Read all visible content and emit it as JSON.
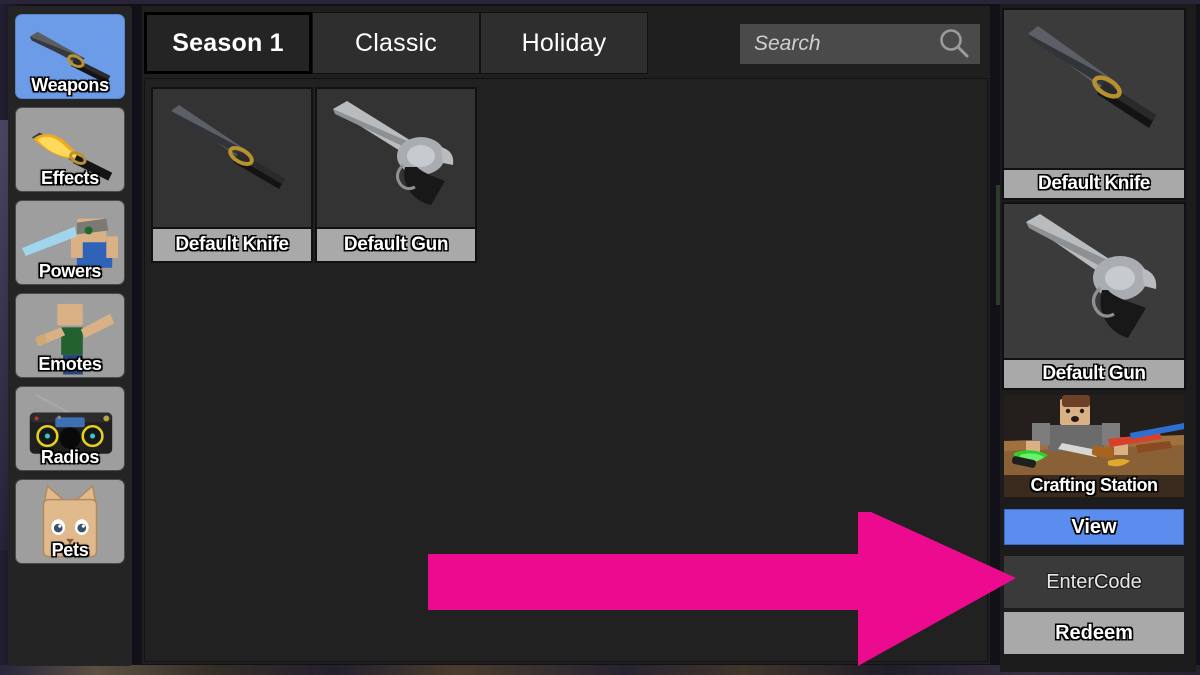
{
  "theme": {
    "panel_bg": "#1f1f1f",
    "content_bg": "#212121",
    "active_tab_bg": "#242424",
    "tab_bg": "#2e2e2e",
    "accent_blue": "#5b8def",
    "sidebar_active_blue": "#6c9ce8",
    "label_gray": "#a9a9a9",
    "annotation_pink": "#ec0b8e"
  },
  "sidebar": {
    "items": [
      {
        "label": "Weapons",
        "icon": "knife-icon",
        "active": true
      },
      {
        "label": "Effects",
        "icon": "flaming-knife-icon",
        "active": false
      },
      {
        "label": "Powers",
        "icon": "laser-power-icon",
        "active": false
      },
      {
        "label": "Emotes",
        "icon": "dab-emote-icon",
        "active": false
      },
      {
        "label": "Radios",
        "icon": "boombox-icon",
        "active": false
      },
      {
        "label": "Pets",
        "icon": "cat-pet-icon",
        "active": false
      }
    ]
  },
  "main": {
    "tabs": [
      {
        "label": "Season 1",
        "active": true
      },
      {
        "label": "Classic",
        "active": false
      },
      {
        "label": "Holiday",
        "active": false
      }
    ],
    "search": {
      "placeholder": "Search",
      "value": "",
      "icon": "search-icon"
    },
    "items": [
      {
        "label": "Default Knife",
        "icon": "knife-item-icon"
      },
      {
        "label": "Default Gun",
        "icon": "revolver-item-icon"
      }
    ]
  },
  "right_panel": {
    "equipped": [
      {
        "label": "Default Knife",
        "icon": "knife-item-icon"
      },
      {
        "label": "Default Gun",
        "icon": "revolver-item-icon"
      }
    ],
    "crafting": {
      "label": "Crafting Station",
      "view_button": "View"
    },
    "code": {
      "input_value": "EnterCode",
      "redeem_button": "Redeem"
    }
  },
  "annotation": {
    "arrow": {
      "direction": "right",
      "color": "#ec0b8e",
      "points_to": "EnterCode"
    }
  }
}
